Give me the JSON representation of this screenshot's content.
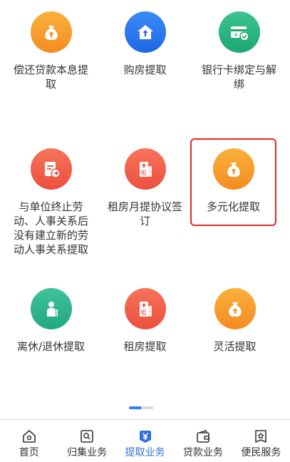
{
  "grid": {
    "items": [
      {
        "label": "偿还贷款本息提取",
        "icon": "money-bag-icon",
        "color": "#f79a2c"
      },
      {
        "label": "购房提取",
        "icon": "house-icon",
        "color": "#2b78ec"
      },
      {
        "label": "银行卡绑定与解绑",
        "icon": "bank-card-icon",
        "color": "#2bb683"
      },
      {
        "label": "与单位终止劳动、人事关系后没有建立新的劳动人事关系提取",
        "icon": "document-arrow-icon",
        "color": "#ef5d48"
      },
      {
        "label": "租房月提协议签订",
        "icon": "rent-building-icon",
        "color": "#ef5d48"
      },
      {
        "label": "多元化提取",
        "icon": "money-bag-icon",
        "color": "#f79a2c"
      },
      {
        "label": "离休/退休提取",
        "icon": "elderly-person-icon",
        "color": "#2eb58c"
      },
      {
        "label": "租房提取",
        "icon": "rent-building-icon",
        "color": "#ef5d48"
      },
      {
        "label": "灵活提取",
        "icon": "money-bag-icon",
        "color": "#f79a2c"
      }
    ]
  },
  "highlight_color": "#e8262b",
  "pager": {
    "active_index": 0,
    "count": 2
  },
  "tabbar": {
    "items": [
      {
        "label": "首页",
        "icon": "home-icon"
      },
      {
        "label": "归集业务",
        "icon": "search-card-icon"
      },
      {
        "label": "提取业务",
        "icon": "yuan-icon"
      },
      {
        "label": "贷款业务",
        "icon": "wallet-icon"
      },
      {
        "label": "便民服务",
        "icon": "star-badge-icon"
      }
    ],
    "active_index": 2,
    "active_color": "#2f6fe0"
  }
}
